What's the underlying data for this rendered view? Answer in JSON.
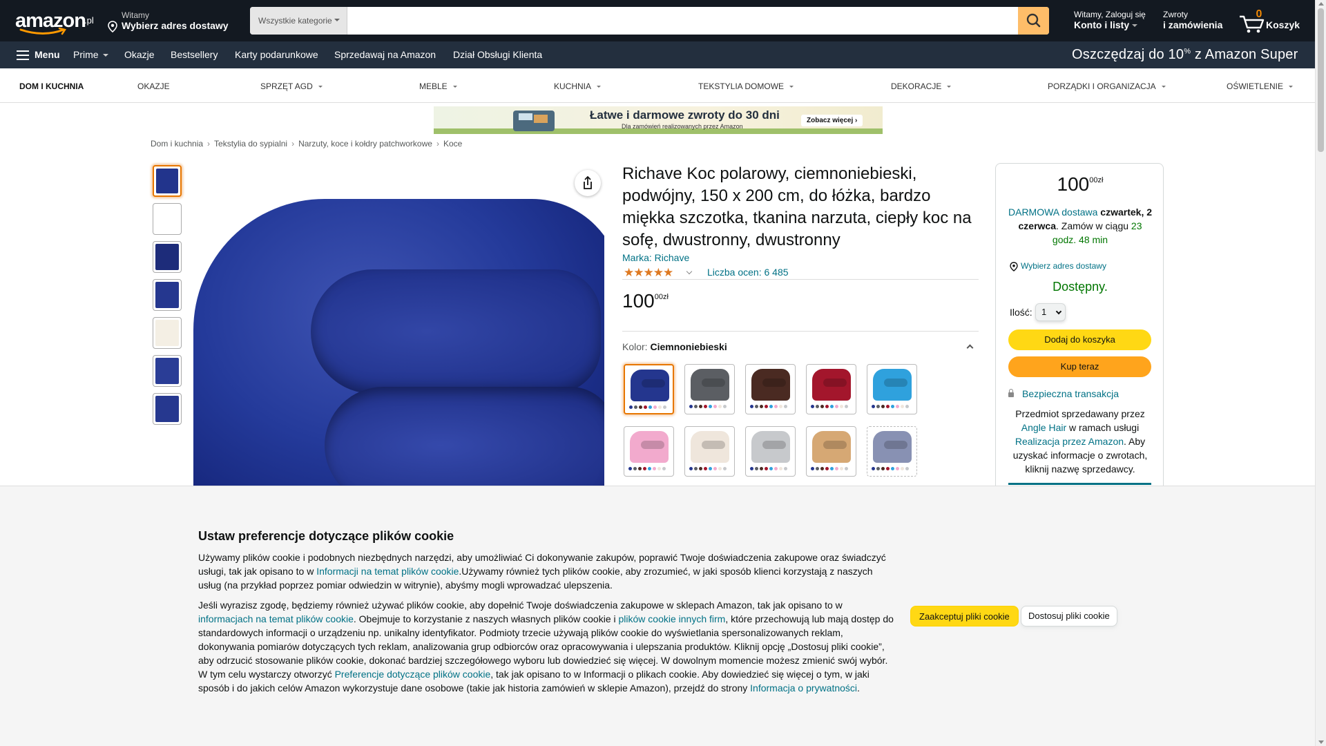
{
  "nav": {
    "logo_text": "amazon",
    "logo_tld": ".pl",
    "deliver_line1": "Witamy",
    "deliver_line2": "Wybierz adres dostawy",
    "search_category": "Wszystkie kategorie",
    "search_placeholder": "",
    "account_line1": "Witamy, Zaloguj się",
    "account_line2": "Konto i listy",
    "returns_line1": "Zwroty",
    "returns_line2": "i zamówienia",
    "cart_count": "0",
    "cart_label": "Koszyk"
  },
  "main_nav": {
    "menu_label": "Menu",
    "items": [
      "Prime",
      "Okazje",
      "Bestsellery",
      "Karty podarunkowe",
      "Sprzedawaj na Amazon",
      "Dział Obsługi Klienta"
    ],
    "promo_text": "Oszczędzaj do 10",
    "promo_sup": "%",
    "promo_tail": " z Amazon Super"
  },
  "category_bar": {
    "items": [
      "DOM I KUCHNIA",
      "OKAZJE",
      "SPRZĘT AGD",
      "MEBLE",
      "KUCHNIA",
      "TEKSTYLIA DOMOWE",
      "DEKORACJE",
      "PORZĄDKI I ORGANIZACJA",
      "OŚWIETLENIE"
    ]
  },
  "banner": {
    "headline": "Łatwe i darmowe zwroty do 30 dni",
    "subline": "Dla zamówień realizowanych przez Amazon",
    "cta": "Zobacz więcej ›"
  },
  "breadcrumb": [
    "Dom i kuchnia",
    "Tekstylia do sypialni",
    "Narzuty, koce i kołdry patchworkowe",
    "Koce"
  ],
  "product": {
    "title": "Richave Koc polarowy, ciemnoniebieski, podwójny, 150 x 200 cm, do łóżka, bardzo miękka szczotka, tkanina narzuta, ciepły koc na sofę, dwustronny, dwustronny",
    "brand": "Marka: Richave",
    "stars": "★★★★★",
    "rating_count": "Liczba ocen: 6 485",
    "price_whole": "100",
    "price_cents": "00",
    "price_currency": "zł",
    "color_prefix": "Kolor: ",
    "color_selected": "Ciemnoniebieski",
    "swatches": [
      {
        "name": "Ciemnoniebieski",
        "color": "#24368e"
      },
      {
        "name": "Szary",
        "color": "#5b5e63"
      },
      {
        "name": "Brązowy",
        "color": "#4a2a22"
      },
      {
        "name": "Czerwony",
        "color": "#a3162c"
      },
      {
        "name": "Niebieski",
        "color": "#2fa1dd"
      },
      {
        "name": "Różowy",
        "color": "#f2aacd"
      },
      {
        "name": "Kremowy",
        "color": "#efe6dc"
      },
      {
        "name": "Srebrny",
        "color": "#c7c9cc"
      },
      {
        "name": "Beżowy",
        "color": "#d6a874"
      },
      {
        "name": "Szaroniebieski",
        "color": "#8891b3"
      }
    ],
    "thumbnail_colors": [
      "#22348c",
      "#ffffff",
      "#1d2c7a",
      "#25378f",
      "#f4efe4",
      "#2a3d96",
      "#26388f"
    ]
  },
  "buybox": {
    "price_whole": "100",
    "price_cents": "00",
    "price_currency": "zł",
    "delivery_link": "DARMOWA dostawa",
    "delivery_date": "czwartek, 2 czerwca",
    "delivery_order": ". Zamów w ciągu",
    "delivery_time": "23 godz. 48 min",
    "location_link": "Wybierz adres dostawy",
    "stock": "Dostępny.",
    "qty_label": "Ilość:",
    "qty_value": "1",
    "add_to_cart": "Dodaj do koszyka",
    "buy_now": "Kup teraz",
    "secure": "Bezpieczna transakcja",
    "seller_1": "Przedmiot sprzedawany przez",
    "seller_name": "Angle Hair",
    "seller_2": "w ramach usługi",
    "seller_fba": "Realizacja przez Amazon",
    "seller_3": ". Aby uzyskać informacje o zwrotach, kliknij nazwę sprzedawcy."
  },
  "cookie": {
    "title": "Ustaw preferencje dotyczące plików cookie",
    "p1_a": "Używamy plików cookie i podobnych niezbędnych narzędzi, aby umożliwiać Ci dokonywanie zakupów, poprawić Twoje doświadczenia zakupowe oraz świadczyć usługi, tak jak opisano to w ",
    "p1_link": "Informacji na temat plików cookie",
    "p1_b": ".Używamy również tych plików cookie, aby zrozumieć, w jaki sposób klienci korzystają z naszych usług (na przykład poprzez pomiar odwiedzin w witrynie), abyśmy mogli wprowadzać ulepszenia.",
    "p2_a": "Jeśli wyrazisz zgodę, będziemy również używać plików cookie, aby dopełnić Twoje doświadczenia zakupowe w sklepach Amazon, tak jak opisano to w ",
    "p2_link1": "informacjach na temat plików cookie",
    "p2_b": ". Obejmuje to korzystanie z naszych własnych plików cookie i ",
    "p2_link2": "plików cookie innych firm",
    "p2_c": ", które przechowują lub mają dostęp do standardowych informacji o urządzeniu np. unikalny identyfikator. Podmioty trzecie używają plików cookie do wyświetlania spersonalizowanych reklam, dokonywania pomiarów dotyczących tych reklam, analizowania grup odbiorców oraz opracowywania i ulepszania produktów. Kliknij opcję „Dostosuj pliki cookie”, aby odrzucić stosowanie plików cookie, dokonać bardziej szczegółowego wyboru lub dowiedzieć się więcej. W dowolnym momencie możesz zmienić swój wybór. W tym celu wystarczy otworzyć ",
    "p2_link3": "Preferencje dotyczące plików cookie",
    "p2_d": ", tak jak opisano to w Informacji o plikach cookie. Aby dowiedzieć się więcej o tym, w jaki sposób i do jakich celów Amazon wykorzystuje dane osobowe (takie jak historia zamówień w sklepie Amazon), przejdź do strony ",
    "p2_link4": "Informacja o prywatności",
    "p2_e": ".",
    "accept": "Zaakceptuj pliki cookie",
    "customize": "Dostosuj pliki cookie"
  }
}
